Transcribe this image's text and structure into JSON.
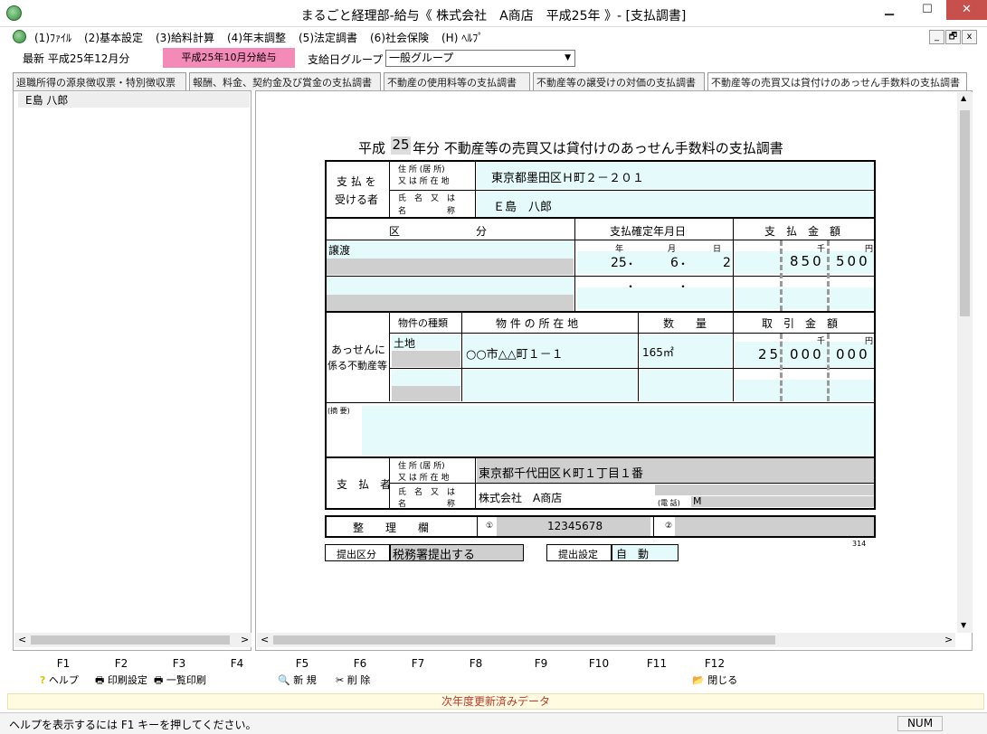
{
  "window": {
    "title": "まるごと経理部-給与《 株式会社　A商店　平成25年 》- [支払調書]",
    "minimize_glyph": "▁",
    "maximize_glyph": "☐",
    "close_glyph": "✕"
  },
  "menu": {
    "items": [
      "(1)ﾌｧｲﾙ",
      "(2)基本設定",
      "(3)給料計算",
      "(4)年末調整",
      "(5)法定調書",
      "(6)社会保険",
      "(H) ﾍﾙﾌﾟ"
    ],
    "mdi_buttons": [
      "_",
      "🗗",
      "x"
    ]
  },
  "toolbar": {
    "latest_label": "最新 平成25年12月分",
    "period_badge": "平成25年10月分給与",
    "group_label": "支給日グループ",
    "group_value": "一般グループ"
  },
  "tabs": [
    "退職所得の源泉徴収票・特別徴収票",
    "報酬、料金、契約金及び賞金の支払調書",
    "不動産の使用料等の支払調書",
    "不動産等の譲受けの対価の支払調書",
    "不動産等の売買又は貸付けのあっせん手数料の支払調書"
  ],
  "tree": {
    "items": [
      "E島 八郎"
    ]
  },
  "form": {
    "title_prefix": "平成",
    "year": "25",
    "title_suffix": "年分  不動産等の売買又は貸付けのあっせん手数料の支払調書",
    "payee": {
      "section_label_1": "支 払 を",
      "section_label_2": "受ける者",
      "address_label_1": "住 所 (居 所)",
      "address_label_2": "又 は 所 在 地",
      "address_value": "東京都墨田区Ｈ町２－２０１",
      "name_label_1": "氏　名　又　は",
      "name_label_2": "名　　　　　称",
      "name_value": "Ｅ島　八郎"
    },
    "headers": {
      "kubun": "区　　　　　　　分",
      "confirm_date": "支払確定年月日",
      "amount": "支　払　金　額"
    },
    "row1": {
      "kubun": "譲渡",
      "year_label": "年",
      "month_label": "月",
      "day_label": "日",
      "year": "25",
      "month": "6",
      "day": "2",
      "date_sep": "・",
      "thousand_label": "千",
      "yen_label": "円",
      "amount_thousand": "850",
      "amount_unit": "500"
    },
    "row2": {
      "date_sep": "・"
    },
    "property": {
      "section_label_1": "あっせんに",
      "section_label_2": "係る不動産等",
      "type_header": "物件の種類",
      "location_header": "物 件 の 所 在 地",
      "quantity_header": "数　　量",
      "trade_header": "取　引　金　額",
      "type_value": "土地",
      "location_value": "○○市△△町１－１",
      "quantity_value": "165㎡",
      "thousand_label": "千",
      "yen_label": "円",
      "trade_million": "25",
      "trade_thousand": "000",
      "trade_unit": "000"
    },
    "remarks_label": "(摘 要)",
    "payer": {
      "section_label": "支　払　者",
      "address_label_1": "住 所 (居 所)",
      "address_label_2": "又 は 所 在 地",
      "address_value": "東京都千代田区Ｋ町１丁目１番",
      "name_label_1": "氏　名　又　は",
      "name_label_2": "名　　　　　称",
      "name_value": "株式会社　A商店",
      "phone_label": "(電 話)",
      "phone_value": "M"
    },
    "seiri": {
      "label": "整　　理　　欄",
      "circle1": "①",
      "value1": "12345678",
      "circle2": "②"
    },
    "form_number": "314",
    "submit_kubun_label": "提出区分",
    "submit_kubun_value": "税務署提出する",
    "submit_setting_label": "提出設定",
    "submit_setting_value": "自　動"
  },
  "fkeys": {
    "keys": [
      "F1",
      "F2",
      "F3",
      "F4",
      "F5",
      "F6",
      "F7",
      "F8",
      "F9",
      "F10",
      "F11",
      "F12"
    ],
    "f1": "ヘルプ",
    "f2": "印刷設定",
    "f3": "一覧印刷",
    "f5": "新 規",
    "f6": "削 除",
    "f12": "閉じる"
  },
  "notice": "次年度更新済みデータ",
  "status": {
    "text": "ヘルプを表示するには F1 キーを押してください。",
    "num": "NUM"
  },
  "scroll": {
    "left_arrow": "<",
    "right_arrow": ">",
    "up_arrow": "▲",
    "down_arrow": "▼"
  }
}
